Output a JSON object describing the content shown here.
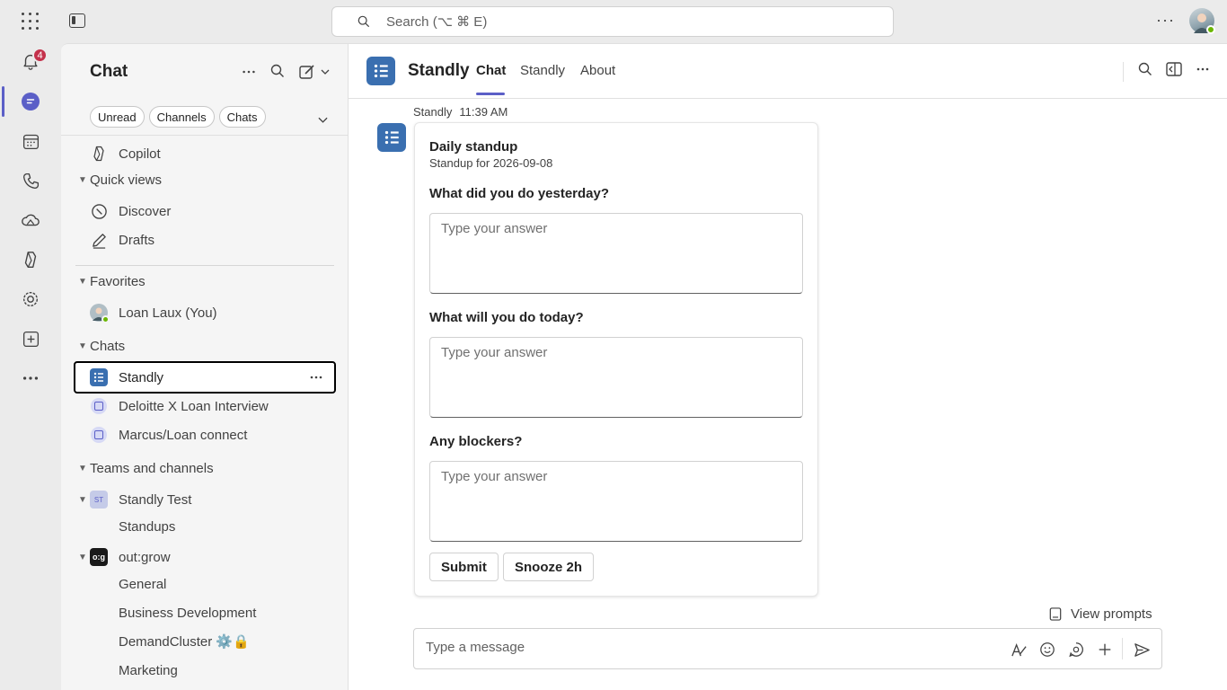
{
  "topbar": {
    "search_placeholder": "Search (⌥ ⌘ E)",
    "more_label": "···"
  },
  "rail": {
    "notification_count": "4"
  },
  "left": {
    "title": "Chat",
    "filters": [
      "Unread",
      "Channels",
      "Chats"
    ],
    "items": {
      "copilot": "Copilot",
      "quick_views": "Quick views",
      "discover": "Discover",
      "drafts": "Drafts",
      "favorites": "Favorites",
      "me": "Loan Laux (You)",
      "chats": "Chats",
      "standly": "Standly",
      "deloitte": "Deloitte X Loan Interview",
      "marcus": "Marcus/Loan connect",
      "teams_channels": "Teams and channels",
      "standly_test": "Standly Test",
      "standly_test_badge": "ST",
      "standups": "Standups",
      "outgrow": "out:grow",
      "outgrow_badge": "o:g",
      "general": "General",
      "bizdev": "Business Development",
      "demandcluster": "DemandCluster ⚙️🔒",
      "marketing": "Marketing"
    }
  },
  "main": {
    "title": "Standly",
    "tabs": [
      "Chat",
      "Standly",
      "About"
    ],
    "message": {
      "sender": "Standly",
      "time": "11:39 AM"
    },
    "card": {
      "title": "Daily standup",
      "subtitle": "Standup for 2026-09-08",
      "questions": [
        "What did you do yesterday?",
        "What will you do today?",
        "Any blockers?"
      ],
      "answer_placeholder": "Type your answer",
      "submit_label": "Submit",
      "snooze_label": "Snooze 2h"
    },
    "view_prompts": "View prompts",
    "compose_placeholder": "Type a message"
  },
  "colors": {
    "accent": "#5b5fc7",
    "app_icon": "#3a6fb0",
    "badge": "#c4314b",
    "presence": "#6bb700"
  }
}
